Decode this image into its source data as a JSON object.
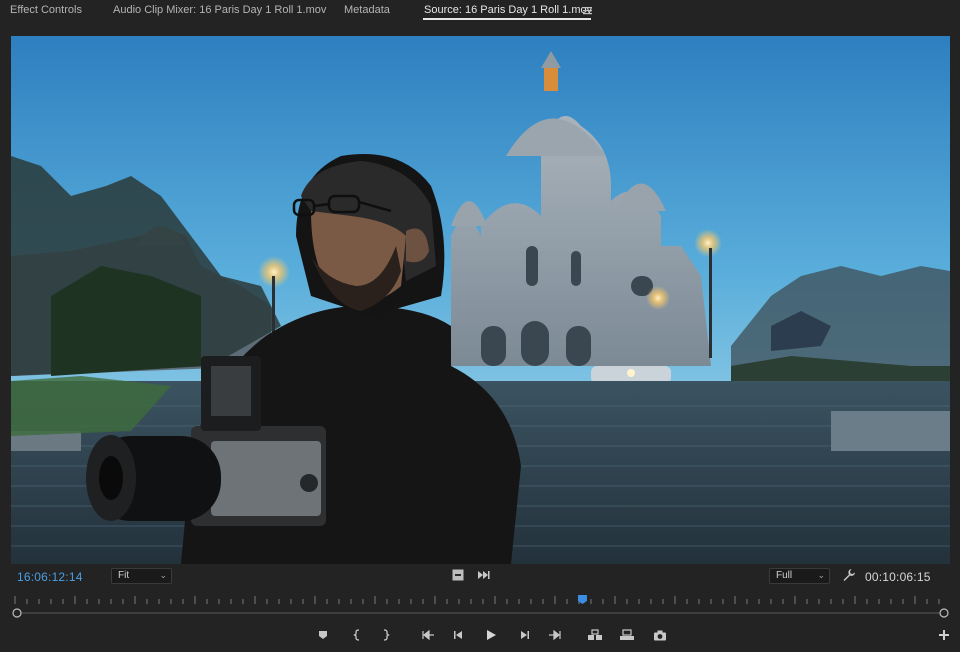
{
  "tabs": [
    {
      "label": "Effect Controls",
      "active": false
    },
    {
      "label": "Audio Clip Mixer: 16 Paris Day 1 Roll 1.mov",
      "active": false
    },
    {
      "label": "Metadata",
      "active": false
    },
    {
      "label": "Source: 16 Paris Day 1 Roll 1.mov",
      "active": true
    }
  ],
  "panel_menu_icon": "hamburger-menu-icon",
  "viewer": {
    "timecode_playhead": "16:06:12:14",
    "zoom": {
      "selected": "Fit"
    },
    "resolution": {
      "selected": "Full"
    },
    "duration": "00:10:06:15",
    "playhead_fraction": 0.61
  },
  "colors": {
    "panel_bg": "#232323",
    "timecode_blue": "#4a9ee3",
    "playhead_blue": "#3a8de0"
  },
  "transport": [
    "add-marker-icon",
    "mark-in-icon",
    "mark-out-icon",
    "go-to-in-icon",
    "step-back-icon",
    "play-icon",
    "step-forward-icon",
    "go-to-out-icon",
    "insert-icon",
    "overwrite-icon",
    "export-frame-icon"
  ],
  "add_button_icon": "plus-icon"
}
